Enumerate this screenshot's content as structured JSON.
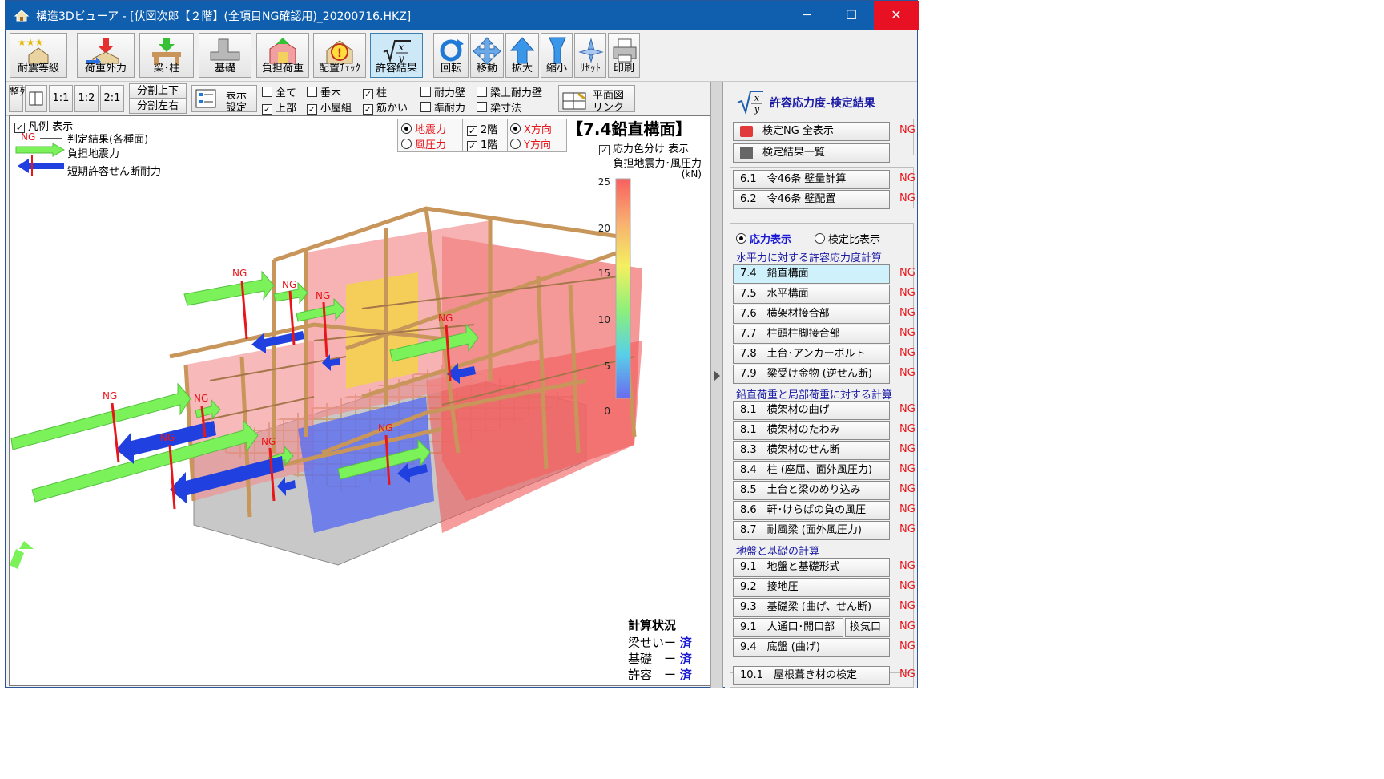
{
  "window": {
    "title": "構造3Dビューア - [伏図次郎【２階】(全項目NG確認用)_20200716.HKZ]",
    "minimize": "─",
    "maximize": "☐",
    "close": "✕"
  },
  "toolbar1": [
    {
      "label": "耐震等級",
      "icon": "stars-house-icon"
    },
    {
      "label": "荷重外力",
      "icon": "load-arrow-icon"
    },
    {
      "label": "梁･柱",
      "icon": "beam-column-icon"
    },
    {
      "label": "基礎",
      "icon": "foundation-icon"
    },
    {
      "label": "負担荷重",
      "icon": "burden-load-icon"
    },
    {
      "label": "配置ﾁｪｯｸ",
      "icon": "warning-icon"
    },
    {
      "label": "許容結果",
      "icon": "sqrt-formula-icon"
    },
    {
      "label": "回転",
      "icon": "rotate-icon"
    },
    {
      "label": "移動",
      "icon": "move-icon"
    },
    {
      "label": "拡大",
      "icon": "zoom-in-icon"
    },
    {
      "label": "縮小",
      "icon": "zoom-out-icon"
    },
    {
      "label": "ﾘｾｯﾄ",
      "icon": "reset-icon"
    },
    {
      "label": "印刷",
      "icon": "print-icon"
    }
  ],
  "toolbar2": {
    "arrange": "整列",
    "ratio1": "1:1",
    "ratio2": "1:2",
    "ratio3": "2:1",
    "split_v": "分割上下",
    "split_h": "分割左右",
    "display_settings_1": "表示",
    "display_settings_2": "設定",
    "checks": [
      {
        "label": "全て",
        "checked": false
      },
      {
        "label": "垂木",
        "checked": false
      },
      {
        "label": "柱",
        "checked": true
      },
      {
        "label": "上部",
        "checked": true
      },
      {
        "label": "小屋組",
        "checked": true
      },
      {
        "label": "筋かい",
        "checked": true
      },
      {
        "label": "耐力壁",
        "checked": false
      },
      {
        "label": "梁上耐力壁",
        "checked": false
      },
      {
        "label": "準耐力",
        "checked": false
      },
      {
        "label": "梁寸法",
        "checked": false
      }
    ],
    "plan_link_1": "平面図",
    "plan_link_2": "リンク"
  },
  "viewport": {
    "legend_toggle": "凡例 表示",
    "legend_ng": "NG",
    "legend_judgement": "判定結果(各種面)",
    "legend_seismic": "負担地震力",
    "legend_shear": "短期許容せん断耐力",
    "radio_seismic": "地震力",
    "radio_wind": "風圧力",
    "floor2": "2階",
    "floor1": "1階",
    "dir_x": "X方向",
    "dir_y": "Y方向",
    "heading": "【7.4鉛直構面】",
    "stress_color": "応力色分け 表示",
    "burden_label": "負担地震力･風圧力",
    "unit": "(kN)",
    "scale_ticks": [
      "25",
      "20",
      "15",
      "10",
      "5",
      "0"
    ],
    "ng_marker": "NG",
    "calc_status_title": "計算状況",
    "calc_rows": [
      {
        "label": "梁せいー",
        "value": "済"
      },
      {
        "label": "基礎　ー",
        "value": "済"
      },
      {
        "label": "許容　ー",
        "value": "済"
      }
    ]
  },
  "colors": {
    "titlebar": "#0f5fae",
    "close": "#e81123",
    "ng": "#e8161b",
    "arrow_green": "#7cf25a",
    "arrow_blue": "#2040e0",
    "section_blue": "#1a1aa6",
    "selected": "#cff1fb"
  },
  "right_panel": {
    "title": "許容応力度-検定結果",
    "ng_all": "検定NG 全表示",
    "result_list": "検定結果一覧",
    "wall_items": [
      {
        "label": "6.1　令46条 壁量計算",
        "status": "NG"
      },
      {
        "label": "6.2　令46条 壁配置",
        "status": "NG"
      }
    ],
    "radio_stress": "応力表示",
    "radio_ratio": "検定比表示",
    "section1": "水平力に対する許容応力度計算",
    "items1": [
      {
        "label": "7.4　鉛直構面",
        "status": "NG"
      },
      {
        "label": "7.5　水平構面",
        "status": "NG"
      },
      {
        "label": "7.6　横架材接合部",
        "status": "NG"
      },
      {
        "label": "7.7　柱頭柱脚接合部",
        "status": "NG"
      },
      {
        "label": "7.8　土台･アンカーボルト",
        "status": "NG"
      },
      {
        "label": "7.9　梁受け金物 (逆せん断)",
        "status": "NG"
      }
    ],
    "section2": "鉛直荷重と局部荷重に対する計算",
    "items2": [
      {
        "label": "8.1　横架材の曲げ",
        "status": "NG"
      },
      {
        "label": "8.1　横架材のたわみ",
        "status": "NG"
      },
      {
        "label": "8.3　横架材のせん断",
        "status": "NG"
      },
      {
        "label": "8.4　柱 (座屈、面外風圧力)",
        "status": "NG"
      },
      {
        "label": "8.5　土台と梁のめり込み",
        "status": "NG"
      },
      {
        "label": "8.6　軒･けらばの負の風圧",
        "status": "NG"
      },
      {
        "label": "8.7　耐風梁 (面外風圧力)",
        "status": "NG"
      }
    ],
    "section3": "地盤と基礎の計算",
    "items3": [
      {
        "label": "9.1　地盤と基礎形式",
        "status": "NG"
      },
      {
        "label": "9.2　接地圧",
        "status": "NG"
      },
      {
        "label": "9.3　基礎梁 (曲げ、せん断)",
        "status": "NG"
      },
      {
        "label": "9.1　人通口･開口部",
        "status": "NG",
        "extra": "換気口"
      },
      {
        "label": "9.4　底盤 (曲げ)",
        "status": "NG"
      }
    ],
    "roof_item": {
      "label": "10.1　屋根葺き材の検定",
      "status": "NG"
    }
  }
}
